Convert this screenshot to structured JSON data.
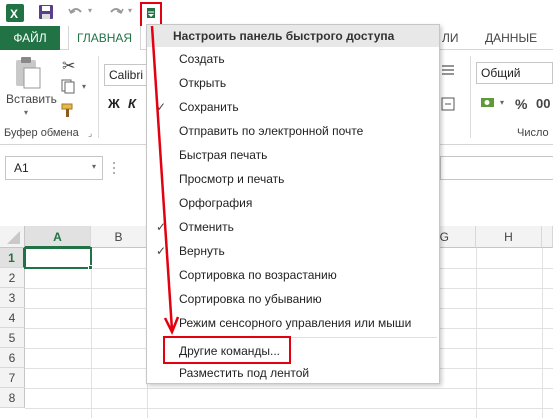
{
  "quick_access": {
    "save_icon": "save-icon",
    "undo_icon": "undo-icon",
    "redo_icon": "redo-icon",
    "customize_icon": "customize-qat-icon"
  },
  "ribbon_tabs": {
    "file": "ФАЙЛ",
    "home": "ГЛАВНАЯ",
    "partial_1": "ЛИ",
    "data": "ДАННЫЕ"
  },
  "ribbon": {
    "paste_label": "Вставить",
    "clipboard_group": "Буфер обмена",
    "font_name": "Calibri",
    "bold": "Ж",
    "italic": "К",
    "number_format": "Общий",
    "percent": "%",
    "number_group": "Число"
  },
  "formula_bar": {
    "name_box": "A1"
  },
  "grid": {
    "columns": [
      "A",
      "B",
      "G",
      "H"
    ],
    "rows": [
      "1",
      "2",
      "3",
      "4",
      "5",
      "6",
      "7",
      "8"
    ]
  },
  "menu": {
    "title": "Настроить панель быстрого доступа",
    "items": [
      {
        "label": "Создать",
        "checked": false
      },
      {
        "label": "Открыть",
        "checked": false
      },
      {
        "label": "Сохранить",
        "checked": true
      },
      {
        "label": "Отправить по электронной почте",
        "checked": false
      },
      {
        "label": "Быстрая печать",
        "checked": false
      },
      {
        "label": "Просмотр и печать",
        "checked": false
      },
      {
        "label": "Орфография",
        "checked": false
      },
      {
        "label": "Отменить",
        "checked": true
      },
      {
        "label": "Вернуть",
        "checked": true
      },
      {
        "label": "Сортировка по возрастанию",
        "checked": false
      },
      {
        "label": "Сортировка по убыванию",
        "checked": false
      },
      {
        "label": "Режим сенсорного управления или мыши",
        "checked": false
      },
      {
        "label": "Другие команды...",
        "checked": false
      },
      {
        "label": "Разместить под лентой",
        "checked": false
      }
    ]
  },
  "colors": {
    "excel_green": "#217346",
    "annotation_red": "#e3000f"
  }
}
